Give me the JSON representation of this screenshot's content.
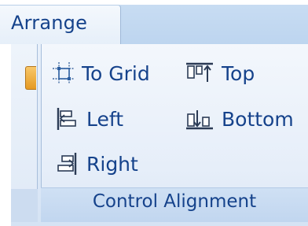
{
  "tab": {
    "label": "Arrange"
  },
  "group": {
    "title": "Control Alignment",
    "commands": {
      "to_grid": {
        "label": "To Grid",
        "icon": "to-grid-icon"
      },
      "top": {
        "label": "Top",
        "icon": "align-top-icon"
      },
      "left": {
        "label": "Left",
        "icon": "align-left-icon"
      },
      "bottom": {
        "label": "Bottom",
        "icon": "align-bottom-icon"
      },
      "right": {
        "label": "Right",
        "icon": "align-right-icon"
      }
    }
  },
  "colors": {
    "label_text": "#15428b",
    "ribbon_bg": "#dbe7f6",
    "tab_strip": "#bfd6f0",
    "accent_orange": "#e59a23"
  }
}
